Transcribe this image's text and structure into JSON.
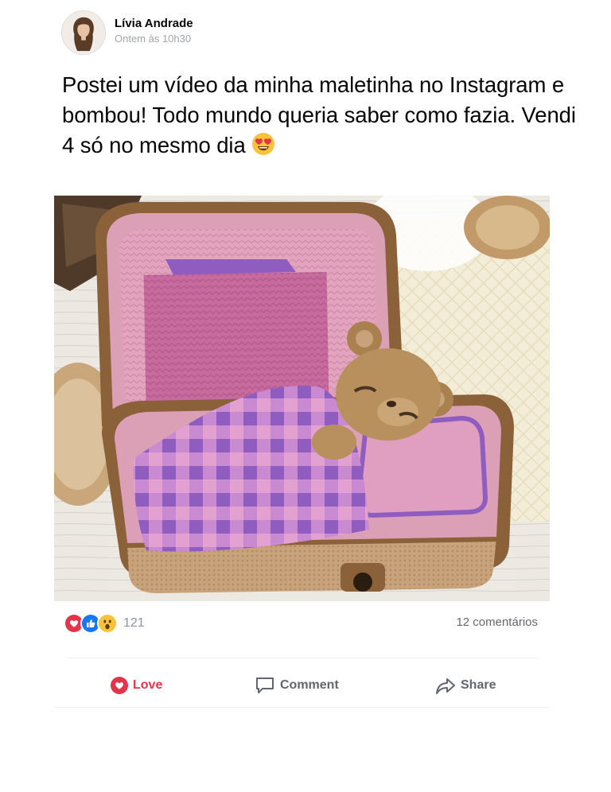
{
  "post": {
    "author": {
      "name": "Lívia Andrade",
      "timestamp": "Ontem às 10h30"
    },
    "text": "Postei um vídeo da minha maletinha no Instagram e bombou! Todo mundo queria saber como fazia. Vendi 4 só no mesmo dia",
    "emoji": "heart-eyes-emoji",
    "image": {
      "alt": ""
    }
  },
  "stats": {
    "reaction_icons": [
      "love-reaction-icon",
      "like-reaction-icon",
      "wow-reaction-icon"
    ],
    "reaction_count": "121",
    "comments": "12 comentários"
  },
  "actions": {
    "love": "Love",
    "comment": "Comment",
    "share": "Share"
  },
  "colors": {
    "love_red": "#e4344b",
    "like_blue": "#1877f2",
    "wow_yellow": "#f7c33b",
    "muted_text": "#65676b"
  }
}
